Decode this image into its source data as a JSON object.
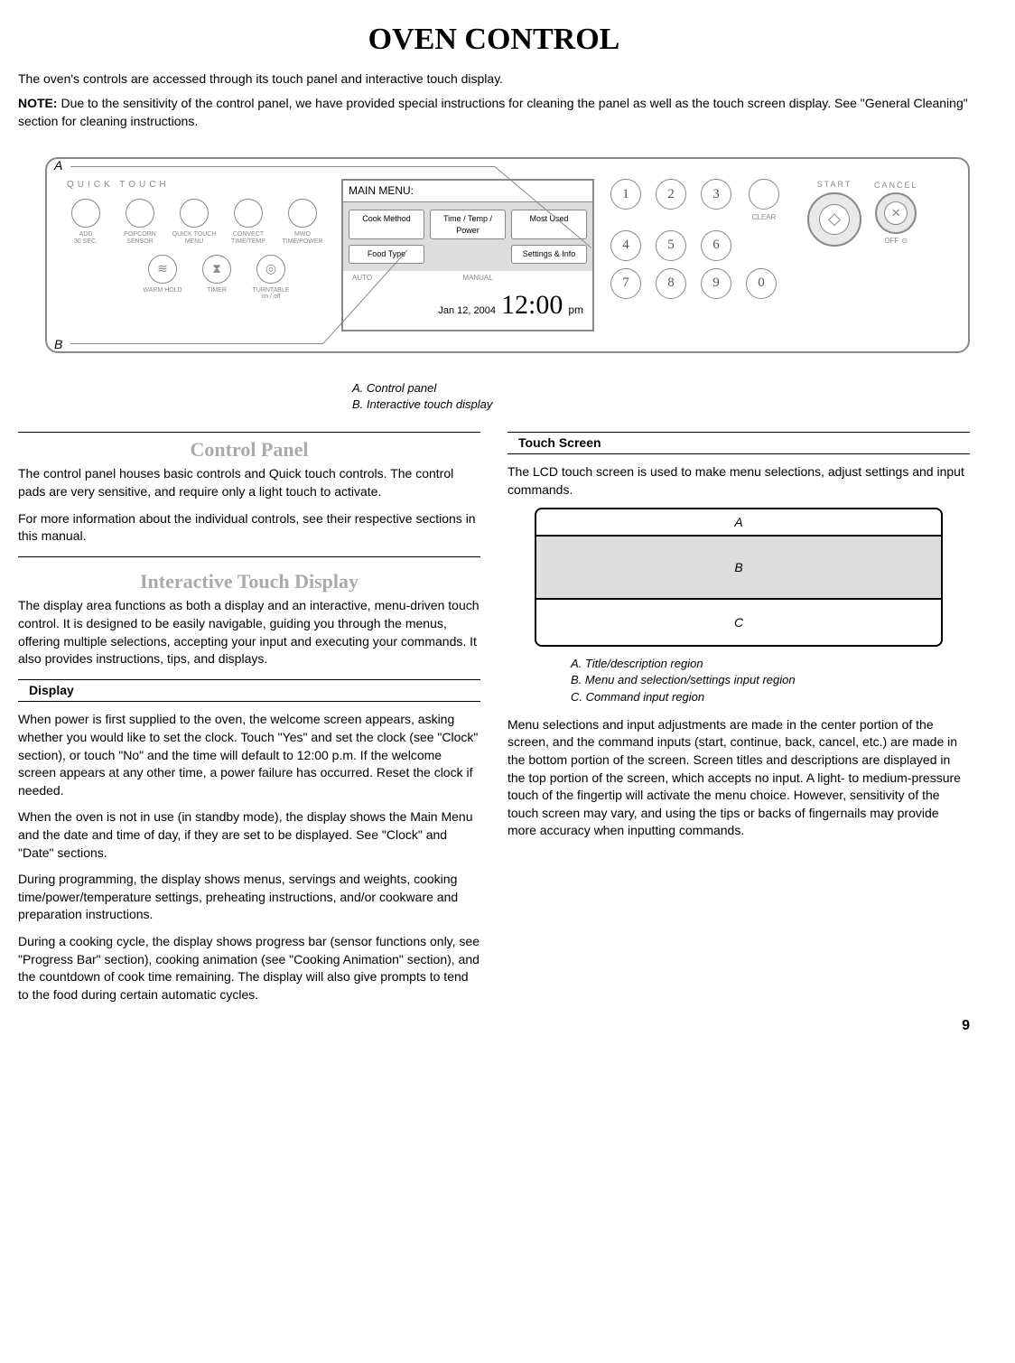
{
  "page": {
    "title": "OVEN CONTROL",
    "number": "9"
  },
  "intro": "The oven's controls are accessed through its touch panel and interactive touch display.",
  "note_label": "NOTE:",
  "note_text": " Due to the sensitivity of the control panel, we have provided special instructions for cleaning the panel as well as the touch screen display. See \"General Cleaning\" section for cleaning instructions.",
  "diagram": {
    "labelA": "A",
    "labelB": "B",
    "caption_a": "A. Control panel",
    "caption_b": "B. Interactive touch display"
  },
  "panel": {
    "qt_title": "QUICK  TOUCH",
    "qt_row1": [
      {
        "label": "ADD\n30 SEC."
      },
      {
        "label": "POPCORN\nSENSOR"
      },
      {
        "label": "QUICK TOUCH\nMENU"
      },
      {
        "label": "CONVECT\nTIME/TEMP"
      },
      {
        "label": "MWO\nTIME/POWER"
      }
    ],
    "qt_row2": [
      {
        "icon": "≋",
        "label": "WARM HOLD"
      },
      {
        "icon": "⧗",
        "label": "TIMER"
      },
      {
        "icon": "◎",
        "label": "TURNTABLE\non / off"
      }
    ],
    "lcd": {
      "title": "MAIN MENU:",
      "chips": [
        "Cook Method",
        "Time / Temp / Power",
        "Most Used",
        "Food Type",
        "",
        "Settings & Info"
      ],
      "auto": "AUTO",
      "manual": "MANUAL",
      "date": "Jan 12, 2004",
      "time": "12:00",
      "ampm": "pm"
    },
    "keypad": {
      "keys": [
        "1",
        "2",
        "3",
        "4",
        "5",
        "6",
        "7",
        "8",
        "9",
        "0"
      ],
      "clear": "CLEAR"
    },
    "start": {
      "arc": "START",
      "icon": "◇"
    },
    "cancel": {
      "arc": "CANCEL",
      "icon": "✕",
      "off": "OFF",
      "lock": "⊙"
    }
  },
  "left": {
    "sec1_title": "Control Panel",
    "sec1_p1": "The control panel houses basic controls and Quick touch controls. The control pads are very sensitive, and require only a light touch to activate.",
    "sec1_p2": "For more information about the individual controls, see their respective sections in this manual.",
    "sec2_title": "Interactive Touch Display",
    "sec2_p1": "The display area functions as both a display and an interactive, menu-driven touch control. It is designed to be easily navigable, guiding you through the menus, offering multiple selections, accepting your input and executing your commands. It also provides instructions, tips, and displays.",
    "sub1_title": "Display",
    "sub1_p1": "When power is first supplied to the oven, the welcome screen appears, asking whether you would like to set the clock. Touch \"Yes\" and set the clock (see \"Clock\" section), or touch \"No\" and the time will default to 12:00 p.m. If the welcome screen appears at any other time, a power failure has occurred. Reset the clock if needed.",
    "sub1_p2": "When the oven is not in use (in standby mode), the display shows the Main Menu and the date and time of day, if they are set to be displayed. See \"Clock\" and \"Date\" sections.",
    "sub1_p3": "During programming, the display shows menus, servings and weights, cooking time/power/temperature settings, preheating instructions, and/or cookware and preparation instructions.",
    "sub1_p4": "During a cooking cycle, the display shows progress bar (sensor functions only, see \"Progress Bar\" section), cooking animation (see \"Cooking Animation\" section), and the countdown of cook time remaining. The display will also give prompts to tend to the food during certain automatic cycles."
  },
  "right": {
    "sub_title": "Touch Screen",
    "p1": "The LCD touch screen is used to make menu selections, adjust settings and input commands.",
    "regions": {
      "a": "A",
      "b": "B",
      "c": "C"
    },
    "caption_a": "A. Title/description region",
    "caption_b": "B. Menu and selection/settings input region",
    "caption_c": "C. Command input region",
    "p2": "Menu selections and input adjustments are made in the center portion of the screen, and the command inputs (start, continue, back, cancel, etc.) are made in the bottom portion of the screen. Screen titles and descriptions are displayed in the top portion of the screen, which accepts no input. A light- to medium-pressure touch of the fingertip will activate the menu choice. However, sensitivity of the touch screen may vary, and using the tips or backs of fingernails may provide more accuracy when inputting commands."
  }
}
